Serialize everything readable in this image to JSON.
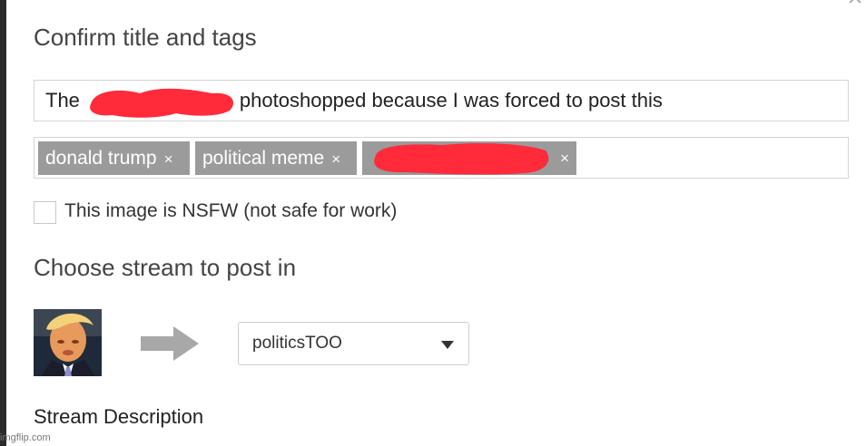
{
  "dialog": {
    "close_glyph": "×",
    "confirm_heading": "Confirm title and tags",
    "title_value_start": "The",
    "title_value_end": "photoshopped because I was forced to post this",
    "tags": [
      {
        "label": "donald trump",
        "remove": "×"
      },
      {
        "label": "political meme",
        "remove": "×"
      },
      {
        "label": "",
        "remove": "×"
      }
    ],
    "nsfw_label": "This image is NSFW (not safe for work)",
    "nsfw_checked": false,
    "stream_heading": "Choose stream to post in",
    "stream_selected": "politicsTOO",
    "stream_description_label": "Stream Description"
  },
  "icons": {
    "close": "close-icon",
    "arrow": "arrow-right-icon",
    "caret": "chevron-down-icon"
  },
  "colors": {
    "tag_bg": "#9b9b9b",
    "redaction": "#ff2a3a",
    "heading": "#444444"
  },
  "watermark": "imgflip.com"
}
